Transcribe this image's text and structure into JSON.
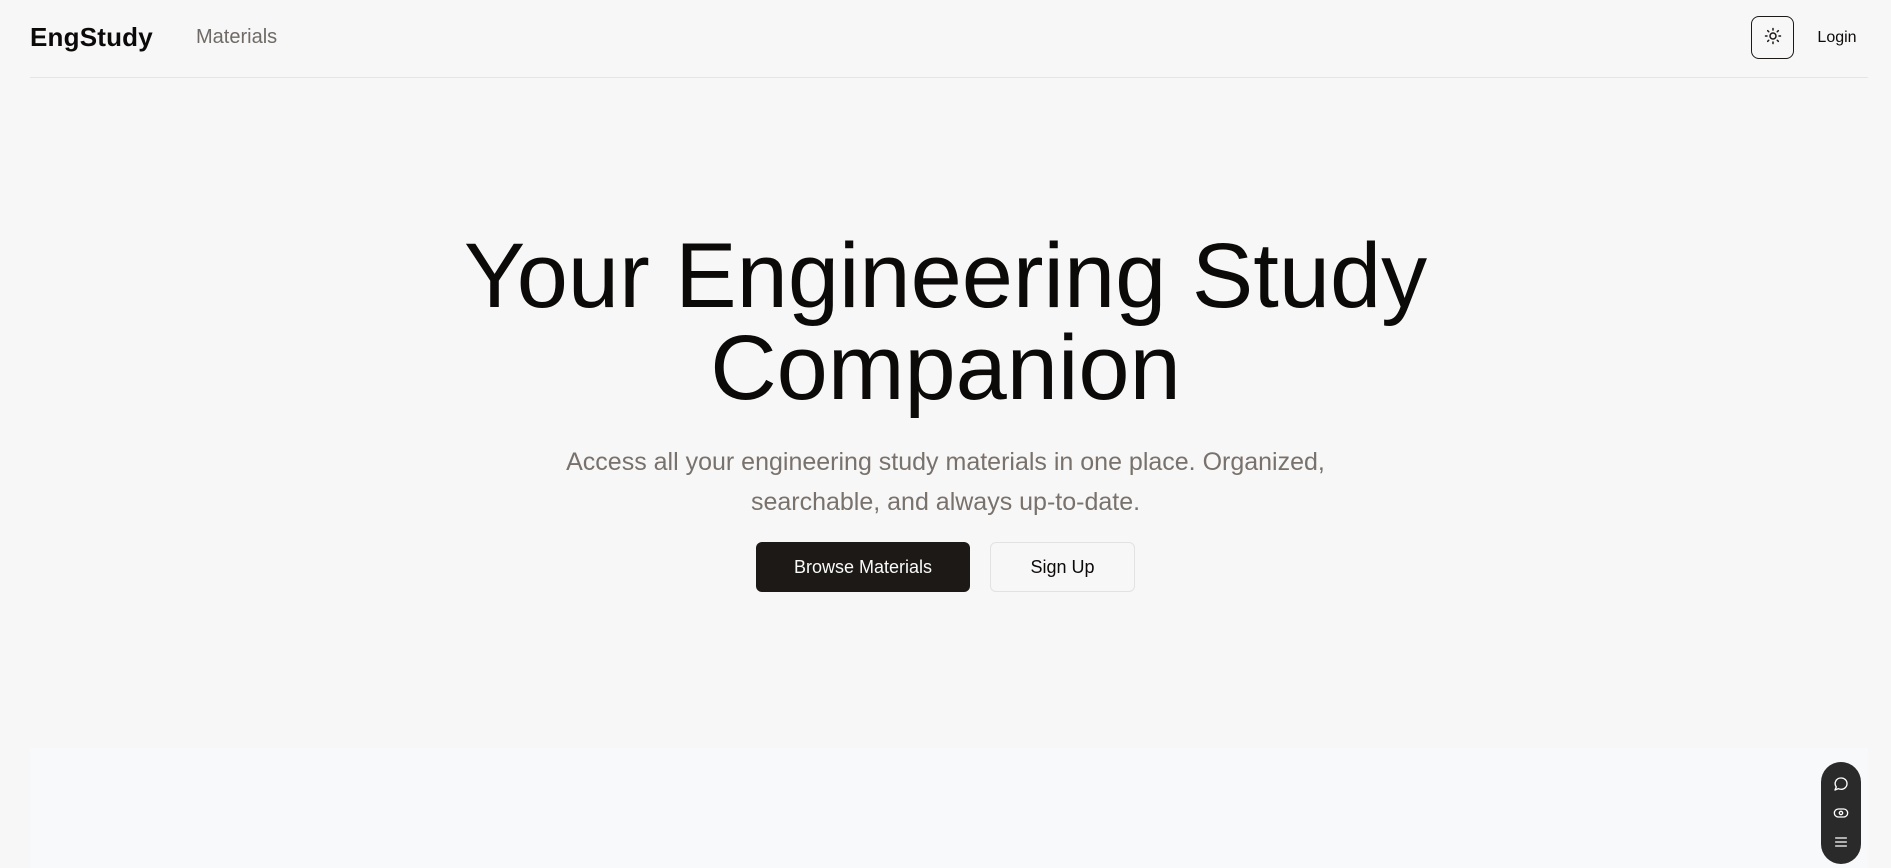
{
  "header": {
    "brand": "EngStudy",
    "nav": {
      "materials_label": "Materials"
    },
    "theme_toggle_icon": "sun-icon",
    "login_label": "Login"
  },
  "hero": {
    "title_line1": "Your Engineering Study",
    "title_line2": "Companion",
    "subtitle_line1": "Access all your engineering study materials in one place. Organized,",
    "subtitle_line2": "searchable, and always up-to-date.",
    "primary_button": "Browse Materials",
    "secondary_button": "Sign Up"
  },
  "floating_toolbar": {
    "icons": [
      "chat-icon",
      "eye-icon",
      "menu-icon"
    ]
  },
  "colors": {
    "background": "#f7f7f7",
    "primary": "#1c1917",
    "muted_text": "#79716b",
    "toolbar": "#2b2a2a"
  }
}
